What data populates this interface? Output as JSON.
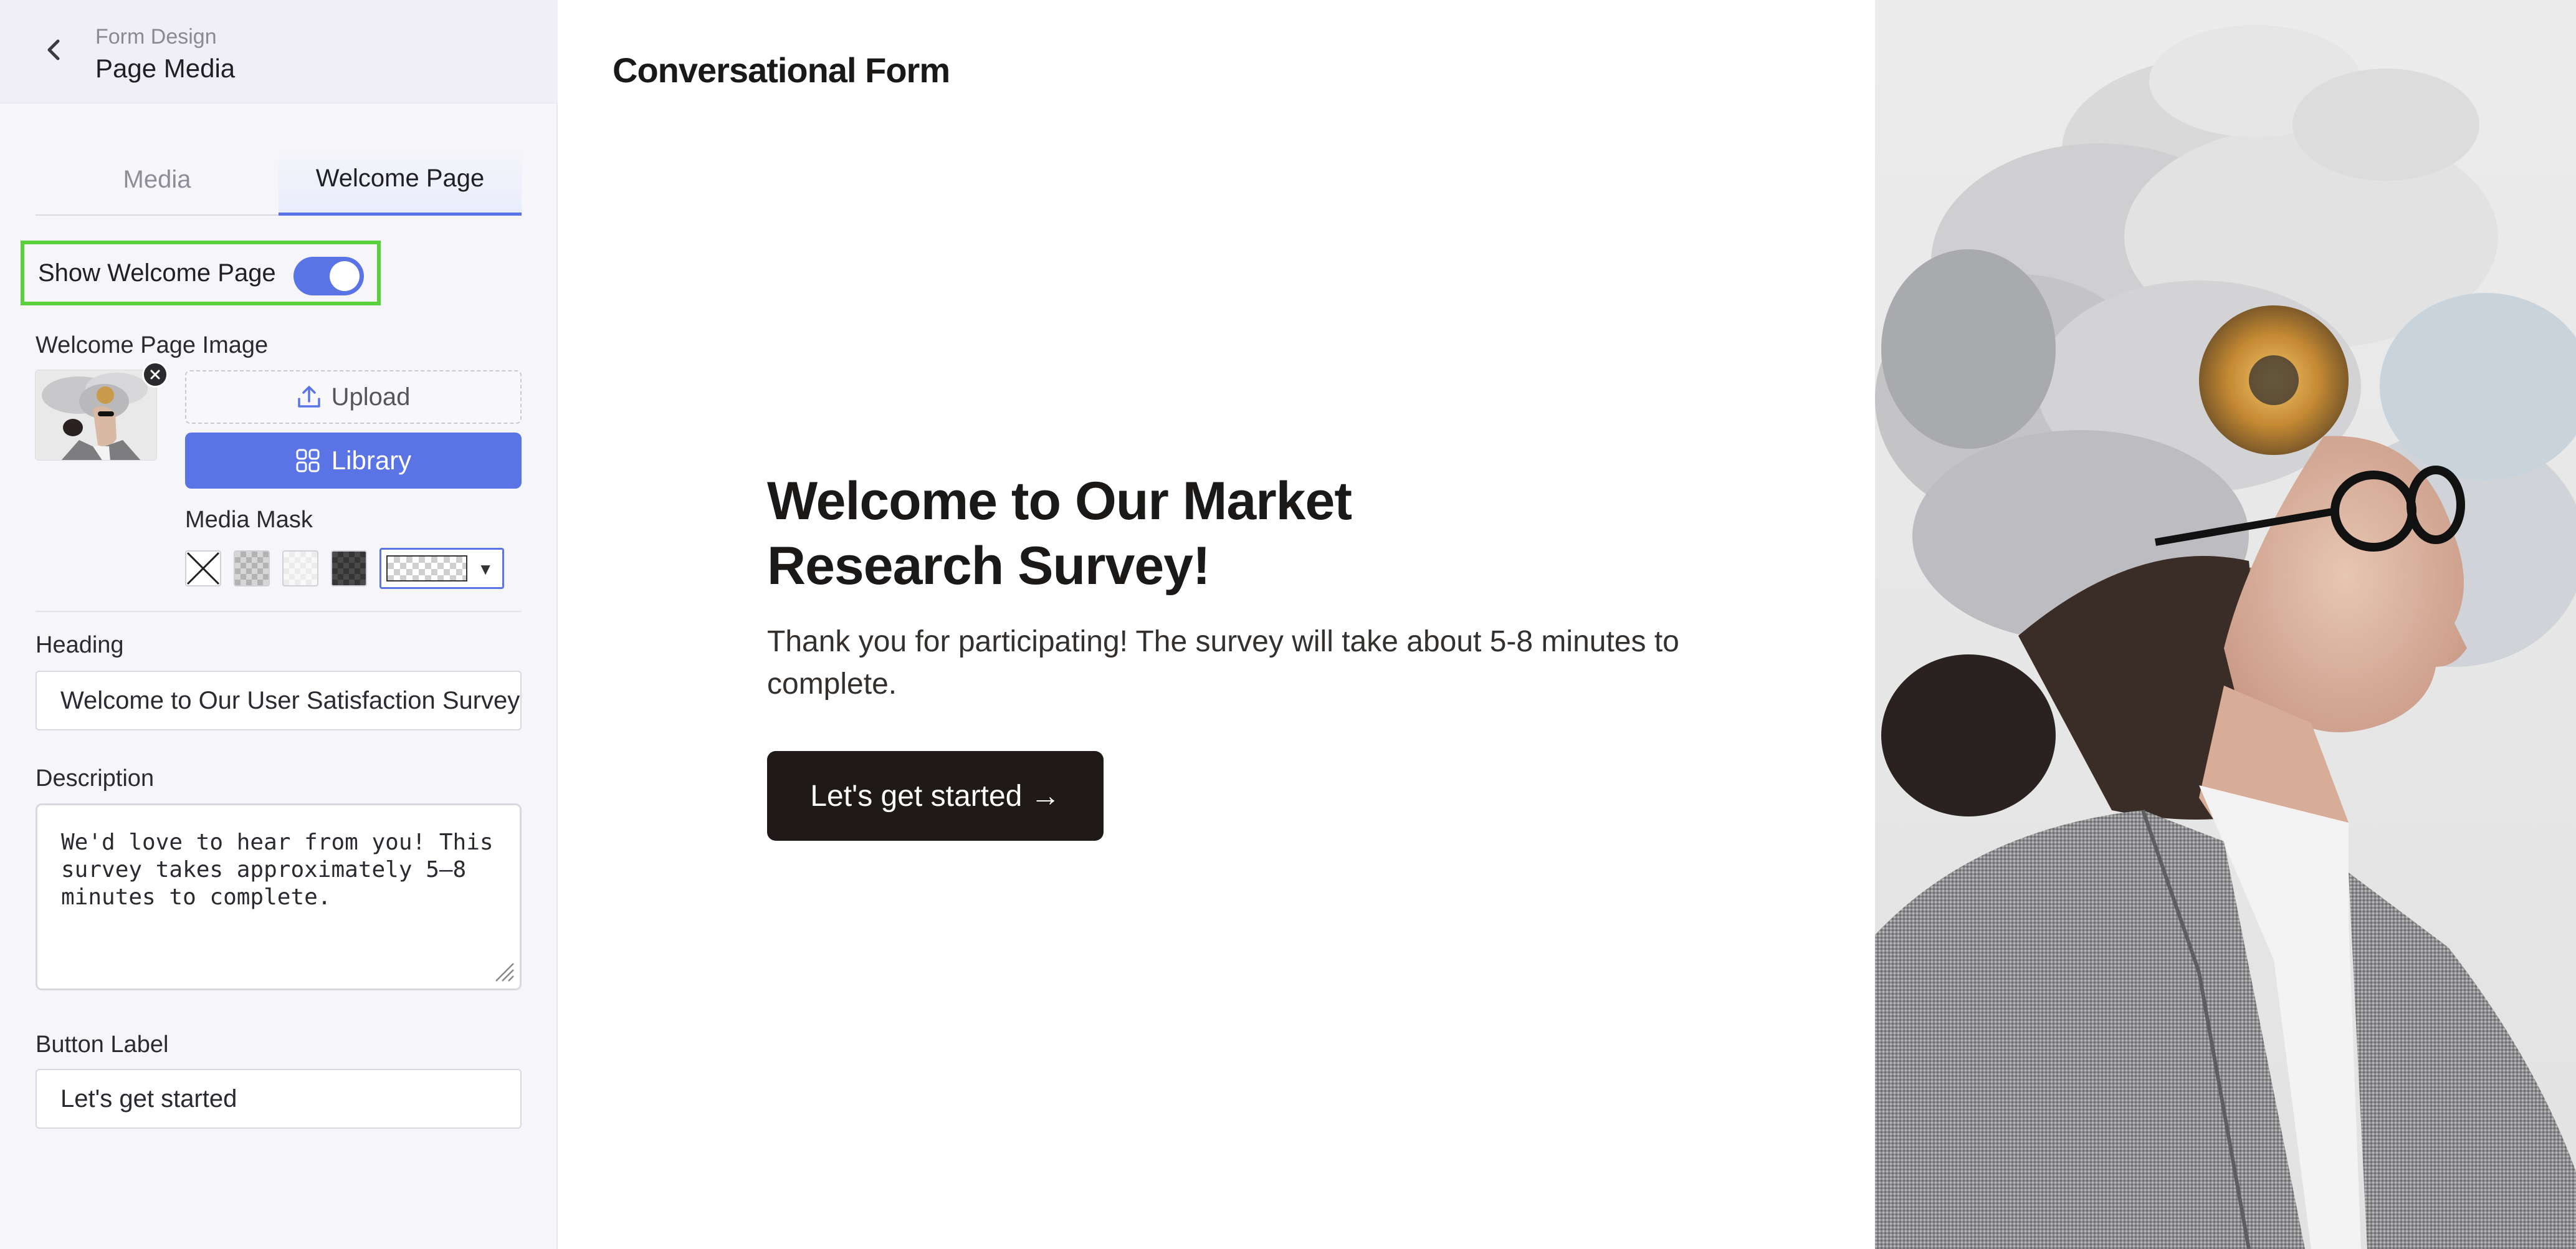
{
  "sidebar": {
    "breadcrumb_parent": "Form Design",
    "page_title": "Page Media",
    "tabs": [
      {
        "label": "Media",
        "active": false
      },
      {
        "label": "Welcome Page",
        "active": true
      }
    ],
    "show_welcome_label": "Show Welcome Page",
    "show_welcome_enabled": true,
    "image_label": "Welcome Page Image",
    "upload_label": "Upload",
    "library_label": "Library",
    "media_mask_label": "Media Mask",
    "heading_label": "Heading",
    "heading_value": "Welcome to Our User Satisfaction Survey!",
    "description_label": "Description",
    "description_value": "We'd love to hear from you! This survey takes approximately 5–8 minutes to complete.",
    "button_label_label": "Button Label",
    "button_label_value": "Let's get started"
  },
  "preview": {
    "form_title": "Conversational Form",
    "heading": "Welcome to Our Market Research Survey!",
    "description": "Thank you for participating! The survey will take about 5-8 minutes to complete.",
    "button": "Let's get started →"
  },
  "colors": {
    "accent": "#5a74e6",
    "highlight_border": "#5ad13a",
    "start_button": "#1f1a17"
  }
}
